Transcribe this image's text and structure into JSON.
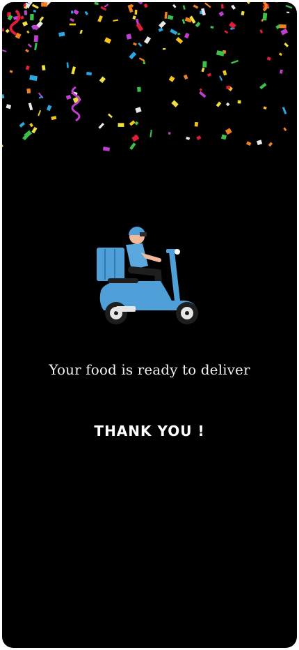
{
  "message": "Your food is ready to deliver",
  "thanks": "THANK YOU !",
  "illustration": {
    "icon": "delivery-scooter-icon"
  },
  "decoration": {
    "icon": "confetti-icon"
  },
  "colors": {
    "background": "#000000",
    "scooter": "#4f9fd8",
    "text": "#ffffff"
  }
}
